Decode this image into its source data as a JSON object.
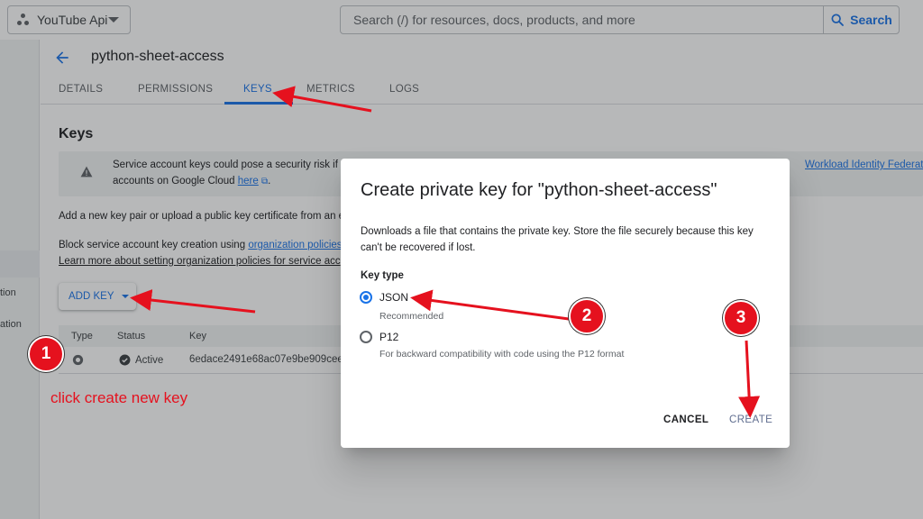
{
  "topbar": {
    "project_name": "YouTube Api",
    "search_placeholder": "Search (/) for resources, docs, products, and more",
    "search_button": "Search"
  },
  "left_rail": {
    "items": [
      "tion",
      "ation"
    ]
  },
  "page": {
    "title": "python-sheet-access",
    "tabs": [
      {
        "label": "DETAILS",
        "active": false
      },
      {
        "label": "PERMISSIONS",
        "active": false
      },
      {
        "label": "KEYS",
        "active": true
      },
      {
        "label": "METRICS",
        "active": false
      },
      {
        "label": "LOGS",
        "active": false
      }
    ],
    "accent_color": "#1a73e8"
  },
  "keys": {
    "heading": "Keys",
    "warning_line1": "Service account keys could pose a security risk if",
    "warning_line2_prefix": "accounts on Google Cloud",
    "warning_link_here": "here",
    "warning_period": ".",
    "warning_link_wif": "Workload Identity Federation",
    "add_pair_text": "Add a new key pair or upload a public key certificate from an e",
    "block_text_prefix": "Block service account key creation using",
    "block_link": "organization policies",
    "learn_more_link": "Learn more about setting organization policies for service acc",
    "add_key_button": "ADD KEY",
    "table": {
      "columns": [
        "Type",
        "Status",
        "Key"
      ],
      "rows": [
        {
          "status": "Active",
          "key": "6edace2491e68ac07e9be909cee"
        }
      ]
    }
  },
  "dialog": {
    "title": "Create private key for \"python-sheet-access\"",
    "description": "Downloads a file that contains the private key. Store the file securely because this key can't be recovered if lost.",
    "key_type_label": "Key type",
    "options": [
      {
        "label": "JSON",
        "hint": "Recommended",
        "selected": true
      },
      {
        "label": "P12",
        "hint": "For backward compatibility with code using the P12 format",
        "selected": false
      }
    ],
    "cancel_button": "CANCEL",
    "create_button": "CREATE"
  },
  "annotations": {
    "badges": [
      "1",
      "2",
      "3"
    ],
    "caption": "click create new key",
    "color": "#e5111e"
  }
}
